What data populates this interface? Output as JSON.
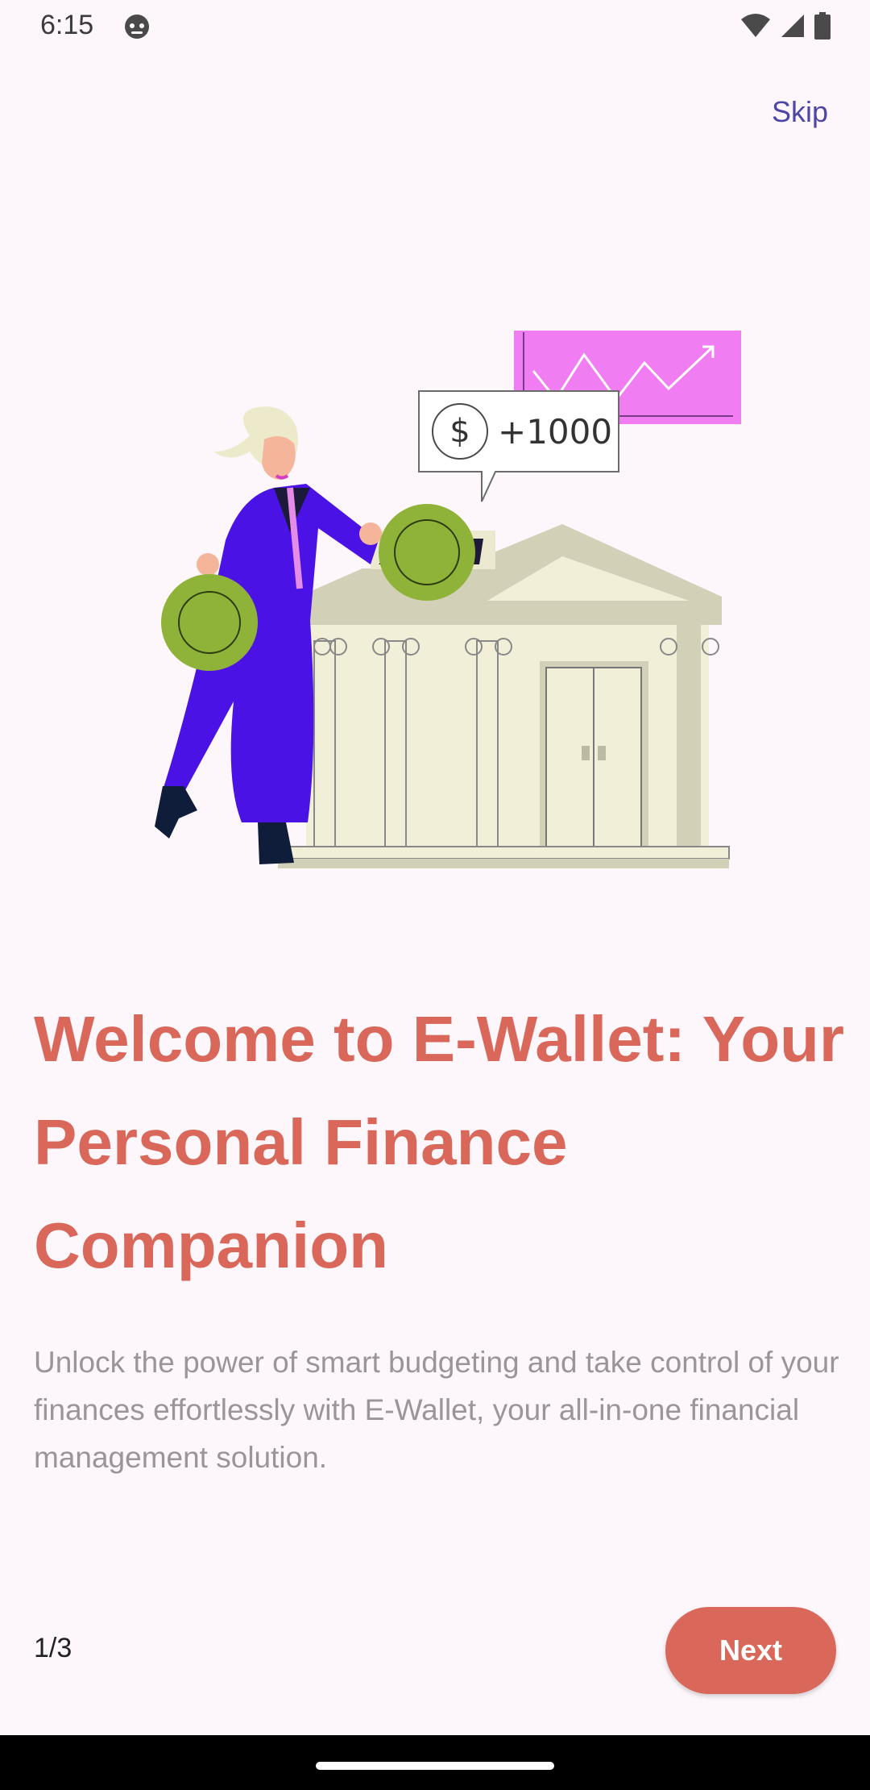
{
  "status_bar": {
    "time": "6:15"
  },
  "header": {
    "skip_label": "Skip"
  },
  "illustration": {
    "speech_bubble_text": "+1000",
    "currency_symbol": "$"
  },
  "content": {
    "title": "Welcome to E-Wallet: Your Personal Finance Companion",
    "subtitle": "Unlock the power of smart budgeting and take control of your finances effortlessly with E-Wallet, your all-in-one financial management solution."
  },
  "footer": {
    "page_indicator": "1/3",
    "next_label": "Next"
  },
  "colors": {
    "accent": "#D9675A",
    "link": "#4E46A6",
    "background": "#FDF7FC"
  }
}
